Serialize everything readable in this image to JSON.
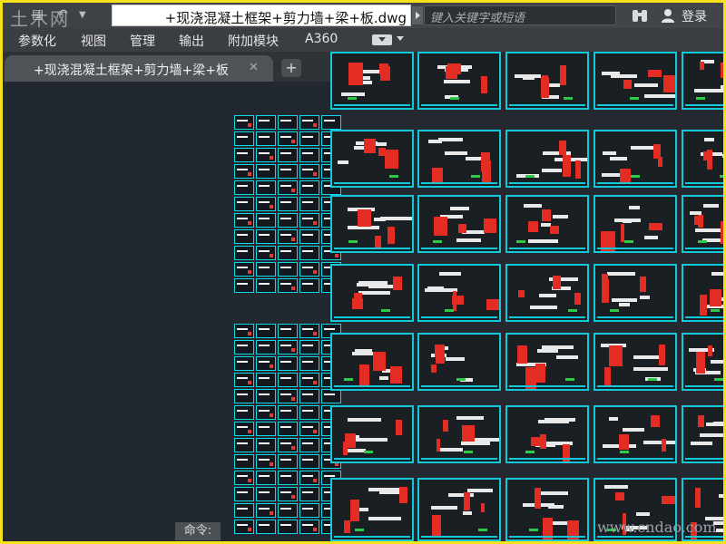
{
  "titlebar": {
    "watermark": "土木网",
    "document_title": "+现浇混凝土框架+剪力墙+梁+板.dwg",
    "search_placeholder": "键入关键字或短语",
    "login_label": "登录",
    "icons": [
      "app-menu-icon",
      "open-icon",
      "dropdown-icon",
      "binoculars-icon",
      "user-icon"
    ]
  },
  "menubar": {
    "items": [
      "参数化",
      "视图",
      "管理",
      "输出",
      "附加模块",
      "A360"
    ]
  },
  "tabs": {
    "active_label": "+现浇混凝土框架+剪力墙+梁+板",
    "close_symbol": "✕",
    "add_symbol": "+"
  },
  "command": {
    "label": "命令:"
  },
  "watermark_bottom": "www.cndao.com",
  "colors": {
    "sheet_border": "#12c9dc",
    "detail_red": "#e32c23",
    "detail_green": "#2ec84a",
    "canvas": "#212830",
    "frame": "#f6e21a"
  }
}
